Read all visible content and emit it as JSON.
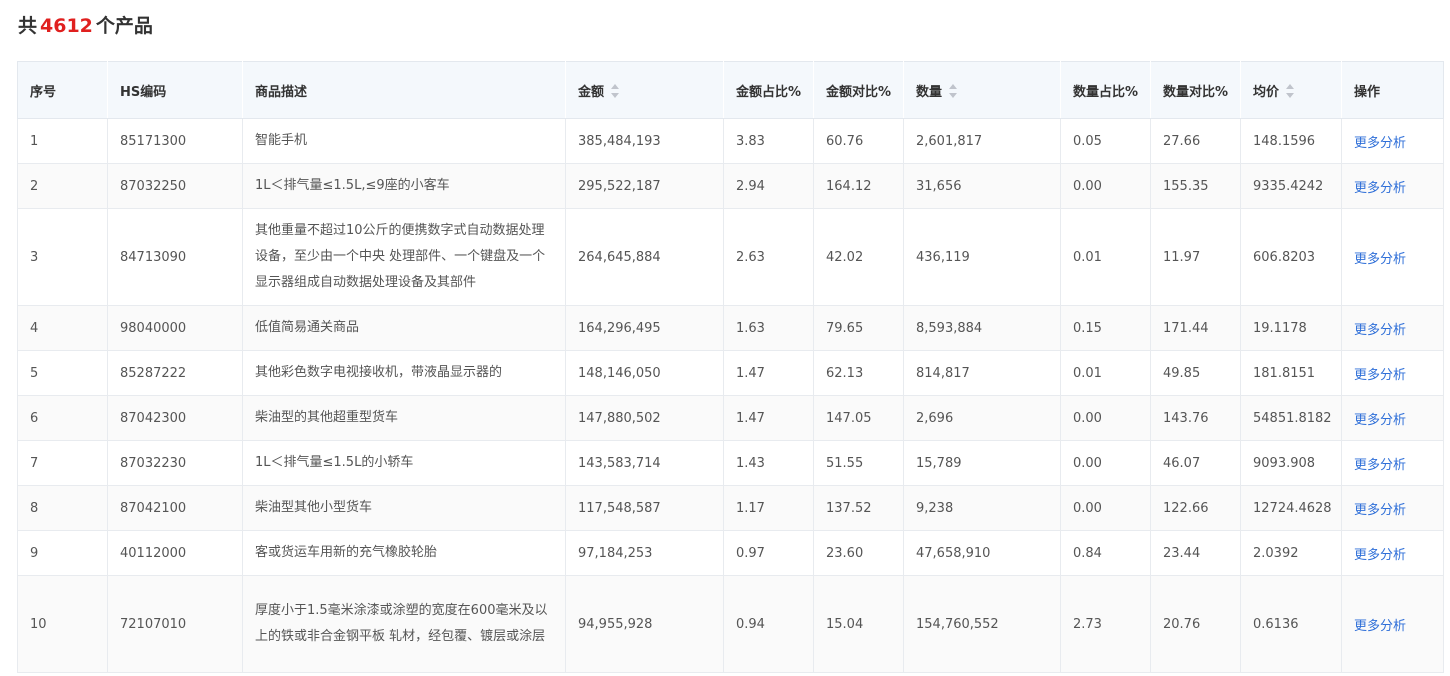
{
  "summary": {
    "prefix": "共",
    "count": "4612",
    "suffix": "个产品"
  },
  "table": {
    "headers": {
      "index": "序号",
      "hs_code": "HS编码",
      "description": "商品描述",
      "amount": "金额",
      "amount_share": "金额占比%",
      "amount_yoy": "金额对比%",
      "quantity": "数量",
      "quantity_share": "数量占比%",
      "quantity_yoy": "数量对比%",
      "avg_price": "均价",
      "action": "操作"
    },
    "rows": [
      {
        "index": "1",
        "hs_code": "85171300",
        "description": "智能手机",
        "amount": "385,484,193",
        "amount_share": "3.83",
        "amount_yoy": "60.76",
        "quantity": "2,601,817",
        "quantity_share": "0.05",
        "quantity_yoy": "27.66",
        "avg_price": "148.1596",
        "action": "更多分析"
      },
      {
        "index": "2",
        "hs_code": "87032250",
        "description": "1L＜排气量≤1.5L,≤9座的小客车",
        "amount": "295,522,187",
        "amount_share": "2.94",
        "amount_yoy": "164.12",
        "quantity": "31,656",
        "quantity_share": "0.00",
        "quantity_yoy": "155.35",
        "avg_price": "9335.4242",
        "action": "更多分析"
      },
      {
        "index": "3",
        "hs_code": "84713090",
        "description": "其他重量不超过10公斤的便携数字式自动数据处理设备，至少由一个中央 处理部件、一个键盘及一个显示器组成自动数据处理设备及其部件",
        "amount": "264,645,884",
        "amount_share": "2.63",
        "amount_yoy": "42.02",
        "quantity": "436,119",
        "quantity_share": "0.01",
        "quantity_yoy": "11.97",
        "avg_price": "606.8203",
        "action": "更多分析"
      },
      {
        "index": "4",
        "hs_code": "98040000",
        "description": "低值简易通关商品",
        "amount": "164,296,495",
        "amount_share": "1.63",
        "amount_yoy": "79.65",
        "quantity": "8,593,884",
        "quantity_share": "0.15",
        "quantity_yoy": "171.44",
        "avg_price": "19.1178",
        "action": "更多分析"
      },
      {
        "index": "5",
        "hs_code": "85287222",
        "description": "其他彩色数字电视接收机，带液晶显示器的",
        "amount": "148,146,050",
        "amount_share": "1.47",
        "amount_yoy": "62.13",
        "quantity": "814,817",
        "quantity_share": "0.01",
        "quantity_yoy": "49.85",
        "avg_price": "181.8151",
        "action": "更多分析"
      },
      {
        "index": "6",
        "hs_code": "87042300",
        "description": "柴油型的其他超重型货车",
        "amount": "147,880,502",
        "amount_share": "1.47",
        "amount_yoy": "147.05",
        "quantity": "2,696",
        "quantity_share": "0.00",
        "quantity_yoy": "143.76",
        "avg_price": "54851.8182",
        "action": "更多分析"
      },
      {
        "index": "7",
        "hs_code": "87032230",
        "description": "1L＜排气量≤1.5L的小轿车",
        "amount": "143,583,714",
        "amount_share": "1.43",
        "amount_yoy": "51.55",
        "quantity": "15,789",
        "quantity_share": "0.00",
        "quantity_yoy": "46.07",
        "avg_price": "9093.908",
        "action": "更多分析"
      },
      {
        "index": "8",
        "hs_code": "87042100",
        "description": "柴油型其他小型货车",
        "amount": "117,548,587",
        "amount_share": "1.17",
        "amount_yoy": "137.52",
        "quantity": "9,238",
        "quantity_share": "0.00",
        "quantity_yoy": "122.66",
        "avg_price": "12724.4628",
        "action": "更多分析"
      },
      {
        "index": "9",
        "hs_code": "40112000",
        "description": "客或货运车用新的充气橡胶轮胎",
        "amount": "97,184,253",
        "amount_share": "0.97",
        "amount_yoy": "23.60",
        "quantity": "47,658,910",
        "quantity_share": "0.84",
        "quantity_yoy": "23.44",
        "avg_price": "2.0392",
        "action": "更多分析"
      },
      {
        "index": "10",
        "hs_code": "72107010",
        "description": "厚度小于1.5毫米涂漆或涂塑的宽度在600毫米及以上的铁或非合金钢平板 轧材，经包覆、镀层或涂层",
        "amount": "94,955,928",
        "amount_share": "0.94",
        "amount_yoy": "15.04",
        "quantity": "154,760,552",
        "quantity_share": "2.73",
        "quantity_yoy": "20.76",
        "avg_price": "0.6136",
        "action": "更多分析"
      }
    ]
  },
  "colors": {
    "accent_count": "#e0201f",
    "link": "#2f6fd8",
    "header_bg": "#f4f8fc"
  },
  "icons": {
    "sort": "sort-caret-icon"
  }
}
